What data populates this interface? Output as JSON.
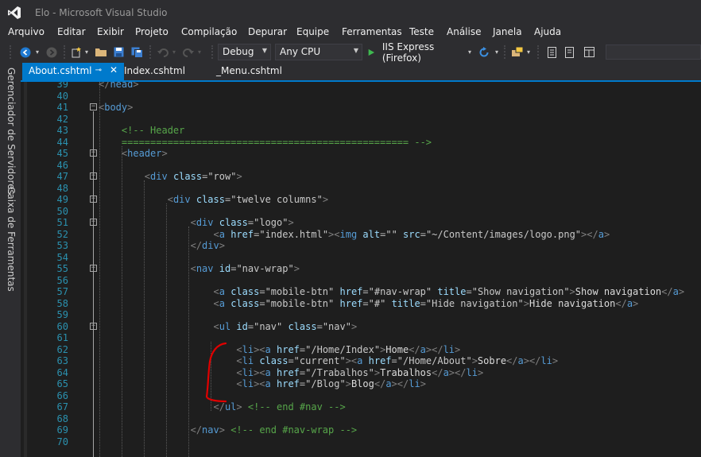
{
  "window": {
    "title": "Elo - Microsoft Visual Studio",
    "logo_icon": "visual-studio-logo-icon",
    "accent_color": "#007acc"
  },
  "menu": [
    "Arquivo",
    "Editar",
    "Exibir",
    "Projeto",
    "Compilação",
    "Depurar",
    "Equipe",
    "Ferramentas",
    "Teste",
    "Análise",
    "Janela",
    "Ajuda"
  ],
  "toolbar": {
    "configuration": "Debug",
    "platform": "Any CPU",
    "run_target": "IIS Express (Firefox)",
    "icons": [
      "back-icon",
      "forward-icon",
      "new-project-icon",
      "open-folder-icon",
      "save-icon",
      "save-all-icon",
      "undo-icon",
      "redo-icon",
      "start-icon",
      "refresh-icon",
      "browser-link-icon",
      "comment-icon",
      "uncomment-icon"
    ]
  },
  "side_panels": [
    "Gerenciador de Servidores",
    "Caixa de Ferramentas"
  ],
  "tabs": [
    {
      "label": "About.cshtml",
      "active": true
    },
    {
      "label": "Index.cshtml",
      "active": false
    },
    {
      "label": "_Menu.cshtml",
      "active": false
    }
  ],
  "tab_pin_glyph": "⊸",
  "tab_close_glyph": "✕",
  "fold_glyph": "−",
  "editor": {
    "lines": [
      {
        "n": "39",
        "fold": false,
        "tokens": [
          [
            "br",
            "</"
          ],
          [
            "tag",
            "head"
          ],
          [
            "br",
            ">"
          ]
        ]
      },
      {
        "n": "40",
        "fold": false,
        "tokens": []
      },
      {
        "n": "41",
        "fold": true,
        "tokens": [
          [
            "br",
            "<"
          ],
          [
            "tag",
            "body"
          ],
          [
            "br",
            ">"
          ]
        ]
      },
      {
        "n": "42",
        "fold": false,
        "tokens": []
      },
      {
        "n": "43",
        "fold": false,
        "tokens": [
          [
            "com",
            "    <!-- Header"
          ]
        ]
      },
      {
        "n": "44",
        "fold": false,
        "tokens": [
          [
            "com",
            "    ================================================== -->"
          ]
        ]
      },
      {
        "n": "45",
        "fold": true,
        "tokens": [
          [
            "txt",
            "    "
          ],
          [
            "br",
            "<"
          ],
          [
            "tag",
            "header"
          ],
          [
            "br",
            ">"
          ]
        ]
      },
      {
        "n": "46",
        "fold": false,
        "tokens": []
      },
      {
        "n": "47",
        "fold": true,
        "tokens": [
          [
            "txt",
            "        "
          ],
          [
            "br",
            "<"
          ],
          [
            "tag",
            "div"
          ],
          [
            "txt",
            " "
          ],
          [
            "attr",
            "class"
          ],
          [
            "eq",
            "="
          ],
          [
            "str",
            "\"row\""
          ],
          [
            "br",
            ">"
          ]
        ]
      },
      {
        "n": "48",
        "fold": false,
        "tokens": []
      },
      {
        "n": "49",
        "fold": true,
        "tokens": [
          [
            "txt",
            "            "
          ],
          [
            "br",
            "<"
          ],
          [
            "tag",
            "div"
          ],
          [
            "txt",
            " "
          ],
          [
            "attr",
            "class"
          ],
          [
            "eq",
            "="
          ],
          [
            "str",
            "\"twelve columns\""
          ],
          [
            "br",
            ">"
          ]
        ]
      },
      {
        "n": "50",
        "fold": false,
        "tokens": []
      },
      {
        "n": "51",
        "fold": true,
        "tokens": [
          [
            "txt",
            "                "
          ],
          [
            "br",
            "<"
          ],
          [
            "tag",
            "div"
          ],
          [
            "txt",
            " "
          ],
          [
            "attr",
            "class"
          ],
          [
            "eq",
            "="
          ],
          [
            "str",
            "\"logo\""
          ],
          [
            "br",
            ">"
          ]
        ]
      },
      {
        "n": "52",
        "fold": false,
        "tokens": [
          [
            "txt",
            "                    "
          ],
          [
            "br",
            "<"
          ],
          [
            "tag",
            "a"
          ],
          [
            "txt",
            " "
          ],
          [
            "attr",
            "href"
          ],
          [
            "eq",
            "="
          ],
          [
            "str",
            "\"index.html\""
          ],
          [
            "br",
            "><"
          ],
          [
            "tag",
            "img"
          ],
          [
            "txt",
            " "
          ],
          [
            "attr",
            "alt"
          ],
          [
            "eq",
            "="
          ],
          [
            "str",
            "\"\""
          ],
          [
            "txt",
            " "
          ],
          [
            "attr",
            "src"
          ],
          [
            "eq",
            "="
          ],
          [
            "str",
            "\"~/Content/images/logo.png\""
          ],
          [
            "br",
            "></"
          ],
          [
            "tag",
            "a"
          ],
          [
            "br",
            ">"
          ]
        ]
      },
      {
        "n": "53",
        "fold": false,
        "tokens": [
          [
            "txt",
            "                "
          ],
          [
            "br",
            "</"
          ],
          [
            "tag",
            "div"
          ],
          [
            "br",
            ">"
          ]
        ]
      },
      {
        "n": "54",
        "fold": false,
        "tokens": []
      },
      {
        "n": "55",
        "fold": true,
        "tokens": [
          [
            "txt",
            "                "
          ],
          [
            "br",
            "<"
          ],
          [
            "tag",
            "nav"
          ],
          [
            "txt",
            " "
          ],
          [
            "attr",
            "id"
          ],
          [
            "eq",
            "="
          ],
          [
            "str",
            "\"nav-wrap\""
          ],
          [
            "br",
            ">"
          ]
        ]
      },
      {
        "n": "56",
        "fold": false,
        "tokens": []
      },
      {
        "n": "57",
        "fold": false,
        "tokens": [
          [
            "txt",
            "                    "
          ],
          [
            "br",
            "<"
          ],
          [
            "tag",
            "a"
          ],
          [
            "txt",
            " "
          ],
          [
            "attr",
            "class"
          ],
          [
            "eq",
            "="
          ],
          [
            "str",
            "\"mobile-btn\""
          ],
          [
            "txt",
            " "
          ],
          [
            "attr",
            "href"
          ],
          [
            "eq",
            "="
          ],
          [
            "str",
            "\"#nav-wrap\""
          ],
          [
            "txt",
            " "
          ],
          [
            "attr",
            "title"
          ],
          [
            "eq",
            "="
          ],
          [
            "str",
            "\"Show navigation\""
          ],
          [
            "br",
            ">"
          ],
          [
            "txt",
            "Show navigation"
          ],
          [
            "br",
            "</"
          ],
          [
            "tag",
            "a"
          ],
          [
            "br",
            ">"
          ]
        ]
      },
      {
        "n": "58",
        "fold": false,
        "tokens": [
          [
            "txt",
            "                    "
          ],
          [
            "br",
            "<"
          ],
          [
            "tag",
            "a"
          ],
          [
            "txt",
            " "
          ],
          [
            "attr",
            "class"
          ],
          [
            "eq",
            "="
          ],
          [
            "str",
            "\"mobile-btn\""
          ],
          [
            "txt",
            " "
          ],
          [
            "attr",
            "href"
          ],
          [
            "eq",
            "="
          ],
          [
            "str",
            "\"#\""
          ],
          [
            "txt",
            " "
          ],
          [
            "attr",
            "title"
          ],
          [
            "eq",
            "="
          ],
          [
            "str",
            "\"Hide navigation\""
          ],
          [
            "br",
            ">"
          ],
          [
            "txt",
            "Hide navigation"
          ],
          [
            "br",
            "</"
          ],
          [
            "tag",
            "a"
          ],
          [
            "br",
            ">"
          ]
        ]
      },
      {
        "n": "59",
        "fold": false,
        "tokens": []
      },
      {
        "n": "60",
        "fold": true,
        "tokens": [
          [
            "txt",
            "                    "
          ],
          [
            "br",
            "<"
          ],
          [
            "tag",
            "ul"
          ],
          [
            "txt",
            " "
          ],
          [
            "attr",
            "id"
          ],
          [
            "eq",
            "="
          ],
          [
            "str",
            "\"nav\""
          ],
          [
            "txt",
            " "
          ],
          [
            "attr",
            "class"
          ],
          [
            "eq",
            "="
          ],
          [
            "str",
            "\"nav\""
          ],
          [
            "br",
            ">"
          ]
        ]
      },
      {
        "n": "61",
        "fold": false,
        "tokens": []
      },
      {
        "n": "62",
        "fold": false,
        "tokens": [
          [
            "txt",
            "                        "
          ],
          [
            "br",
            "<"
          ],
          [
            "tag",
            "li"
          ],
          [
            "br",
            "><"
          ],
          [
            "tag",
            "a"
          ],
          [
            "txt",
            " "
          ],
          [
            "attr",
            "href"
          ],
          [
            "eq",
            "="
          ],
          [
            "str",
            "\"/Home/Index\""
          ],
          [
            "br",
            ">"
          ],
          [
            "txt",
            "Home"
          ],
          [
            "br",
            "</"
          ],
          [
            "tag",
            "a"
          ],
          [
            "br",
            "></"
          ],
          [
            "tag",
            "li"
          ],
          [
            "br",
            ">"
          ]
        ]
      },
      {
        "n": "63",
        "fold": false,
        "tokens": [
          [
            "txt",
            "                        "
          ],
          [
            "br",
            "<"
          ],
          [
            "tag",
            "li"
          ],
          [
            "txt",
            " "
          ],
          [
            "attr",
            "class"
          ],
          [
            "eq",
            "="
          ],
          [
            "str",
            "\"current\""
          ],
          [
            "br",
            "><"
          ],
          [
            "tag",
            "a"
          ],
          [
            "txt",
            " "
          ],
          [
            "attr",
            "href"
          ],
          [
            "eq",
            "="
          ],
          [
            "str",
            "\"/Home/About\""
          ],
          [
            "br",
            ">"
          ],
          [
            "txt",
            "Sobre"
          ],
          [
            "br",
            "</"
          ],
          [
            "tag",
            "a"
          ],
          [
            "br",
            "></"
          ],
          [
            "tag",
            "li"
          ],
          [
            "br",
            ">"
          ]
        ]
      },
      {
        "n": "64",
        "fold": false,
        "tokens": [
          [
            "txt",
            "                        "
          ],
          [
            "br",
            "<"
          ],
          [
            "tag",
            "li"
          ],
          [
            "br",
            "><"
          ],
          [
            "tag",
            "a"
          ],
          [
            "txt",
            " "
          ],
          [
            "attr",
            "href"
          ],
          [
            "eq",
            "="
          ],
          [
            "str",
            "\"/Trabalhos\""
          ],
          [
            "br",
            ">"
          ],
          [
            "txt",
            "Trabalhos"
          ],
          [
            "br",
            "</"
          ],
          [
            "tag",
            "a"
          ],
          [
            "br",
            "></"
          ],
          [
            "tag",
            "li"
          ],
          [
            "br",
            ">"
          ]
        ]
      },
      {
        "n": "65",
        "fold": false,
        "tokens": [
          [
            "txt",
            "                        "
          ],
          [
            "br",
            "<"
          ],
          [
            "tag",
            "li"
          ],
          [
            "br",
            "><"
          ],
          [
            "tag",
            "a"
          ],
          [
            "txt",
            " "
          ],
          [
            "attr",
            "href"
          ],
          [
            "eq",
            "="
          ],
          [
            "str",
            "\"/Blog\""
          ],
          [
            "br",
            ">"
          ],
          [
            "txt",
            "Blog"
          ],
          [
            "br",
            "</"
          ],
          [
            "tag",
            "a"
          ],
          [
            "br",
            "></"
          ],
          [
            "tag",
            "li"
          ],
          [
            "br",
            ">"
          ]
        ]
      },
      {
        "n": "66",
        "fold": false,
        "tokens": []
      },
      {
        "n": "67",
        "fold": false,
        "tokens": [
          [
            "txt",
            "                    "
          ],
          [
            "br",
            "</"
          ],
          [
            "tag",
            "ul"
          ],
          [
            "br",
            ">"
          ],
          [
            "txt",
            " "
          ],
          [
            "com",
            "<!-- end #nav -->"
          ]
        ]
      },
      {
        "n": "68",
        "fold": false,
        "tokens": []
      },
      {
        "n": "69",
        "fold": false,
        "tokens": [
          [
            "txt",
            "                "
          ],
          [
            "br",
            "</"
          ],
          [
            "tag",
            "nav"
          ],
          [
            "br",
            ">"
          ],
          [
            "txt",
            " "
          ],
          [
            "com",
            "<!-- end #nav-wrap -->"
          ]
        ]
      },
      {
        "n": "70",
        "fold": false,
        "tokens": []
      }
    ]
  }
}
